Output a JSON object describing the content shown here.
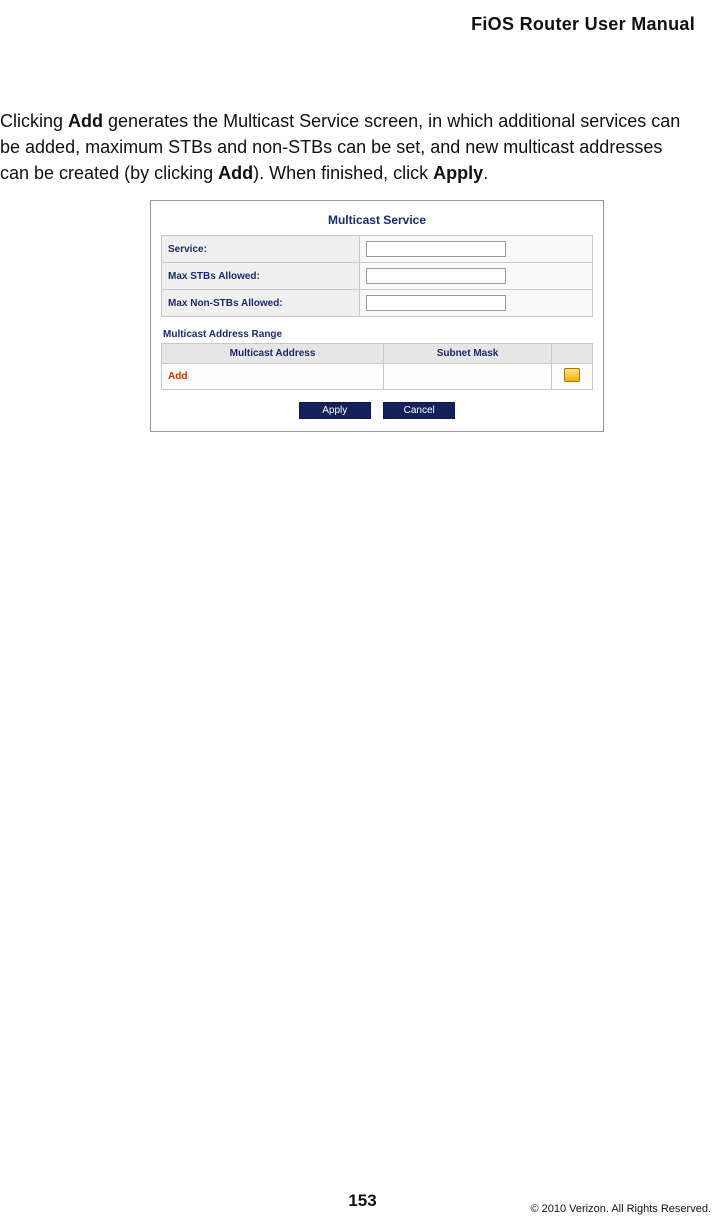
{
  "header": {
    "title": "FiOS Router User Manual"
  },
  "body": {
    "p1_seg1": "Clicking ",
    "p1_seg2_bold": "Add",
    "p1_seg3": " generates the Multicast Service screen, in which additional services can be added, maximum STBs and non-STBs can be set, and new multicast addresses can be created (by clicking ",
    "p1_seg4_bold": "Add",
    "p1_seg5": "). When finished, click ",
    "p1_seg6_bold": "Apply",
    "p1_seg7": "."
  },
  "panel": {
    "title": "Multicast Service",
    "rows": {
      "service": {
        "label": "Service:",
        "value": ""
      },
      "max_stb": {
        "label": "Max STBs Allowed:",
        "value": ""
      },
      "max_nonstb": {
        "label": "Max Non-STBs Allowed:",
        "value": ""
      }
    },
    "section_label": "Multicast Address Range",
    "addr_table": {
      "col1": "Multicast Address",
      "col2": "Subnet Mask",
      "add_link": "Add"
    },
    "buttons": {
      "apply": "Apply",
      "cancel": "Cancel"
    }
  },
  "footer": {
    "page": "153",
    "copyright": "© 2010 Verizon. All Rights Reserved."
  }
}
